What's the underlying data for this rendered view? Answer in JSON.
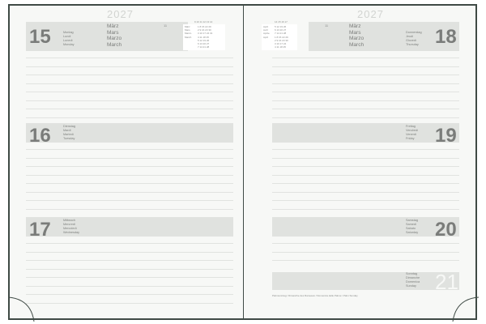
{
  "year": "2027",
  "left": {
    "week": "11",
    "header_months": [
      "März",
      "Mars",
      "Marzo",
      "March"
    ],
    "mini_calendar": {
      "week_numbers": "9  10  11  12  13  14",
      "rows": [
        {
          "label": "März",
          "nums": "1   8  15  22  29"
        },
        {
          "label": "Mars",
          "nums": "2   9  16  23  30"
        },
        {
          "label": "Marzo",
          "nums": "3  10  17  24  31"
        },
        {
          "label": "March",
          "nums": "4  11  18  25"
        },
        {
          "label": "",
          "nums": "5  12  19  26"
        },
        {
          "label": "",
          "nums": "6  13  20  27"
        },
        {
          "label": "",
          "nums": "7  14  21  28"
        }
      ]
    },
    "days": [
      {
        "num": "15",
        "names": [
          "Montag",
          "Lundi",
          "Lunedì",
          "Monday"
        ]
      },
      {
        "num": "16",
        "names": [
          "Dienstag",
          "Mardi",
          "Martedì",
          "Tuesday"
        ]
      },
      {
        "num": "17",
        "names": [
          "Mittwoch",
          "Mercredi",
          "Mercoledì",
          "Wednesday"
        ]
      }
    ]
  },
  "right": {
    "week": "11",
    "header_months": [
      "März",
      "Mars",
      "Marzo",
      "March"
    ],
    "mini_calendar": {
      "week_numbers": "14  15  16  17",
      "rows": [
        {
          "label": "April",
          "nums": "5  12  19  26"
        },
        {
          "label": "Avril",
          "nums": "6  13  20  27"
        },
        {
          "label": "Aprile",
          "nums": "7  14  21  28"
        },
        {
          "label": "April",
          "nums": "1   8  15  22  29"
        },
        {
          "label": "",
          "nums": "2   9  16  23  30"
        },
        {
          "label": "",
          "nums": "3  10  17  24"
        },
        {
          "label": "",
          "nums": "4  11  18  25"
        }
      ]
    },
    "days": [
      {
        "num": "18",
        "names": [
          "Donnerstag",
          "Jeudi",
          "Giovedì",
          "Thursday"
        ]
      },
      {
        "num": "19",
        "names": [
          "Freitag",
          "Vendredi",
          "Venerdì",
          "Friday"
        ]
      },
      {
        "num": "20",
        "names": [
          "Samstag",
          "Samedi",
          "Sabato",
          "Saturday"
        ]
      },
      {
        "num": "21",
        "names": [
          "Sonntag",
          "Dimanche",
          "Domenica",
          "Sunday"
        ]
      }
    ],
    "footnote": "Palmsonntag / Dimanche des Rameaux / Domenica delle Palme / Palm Sunday"
  }
}
